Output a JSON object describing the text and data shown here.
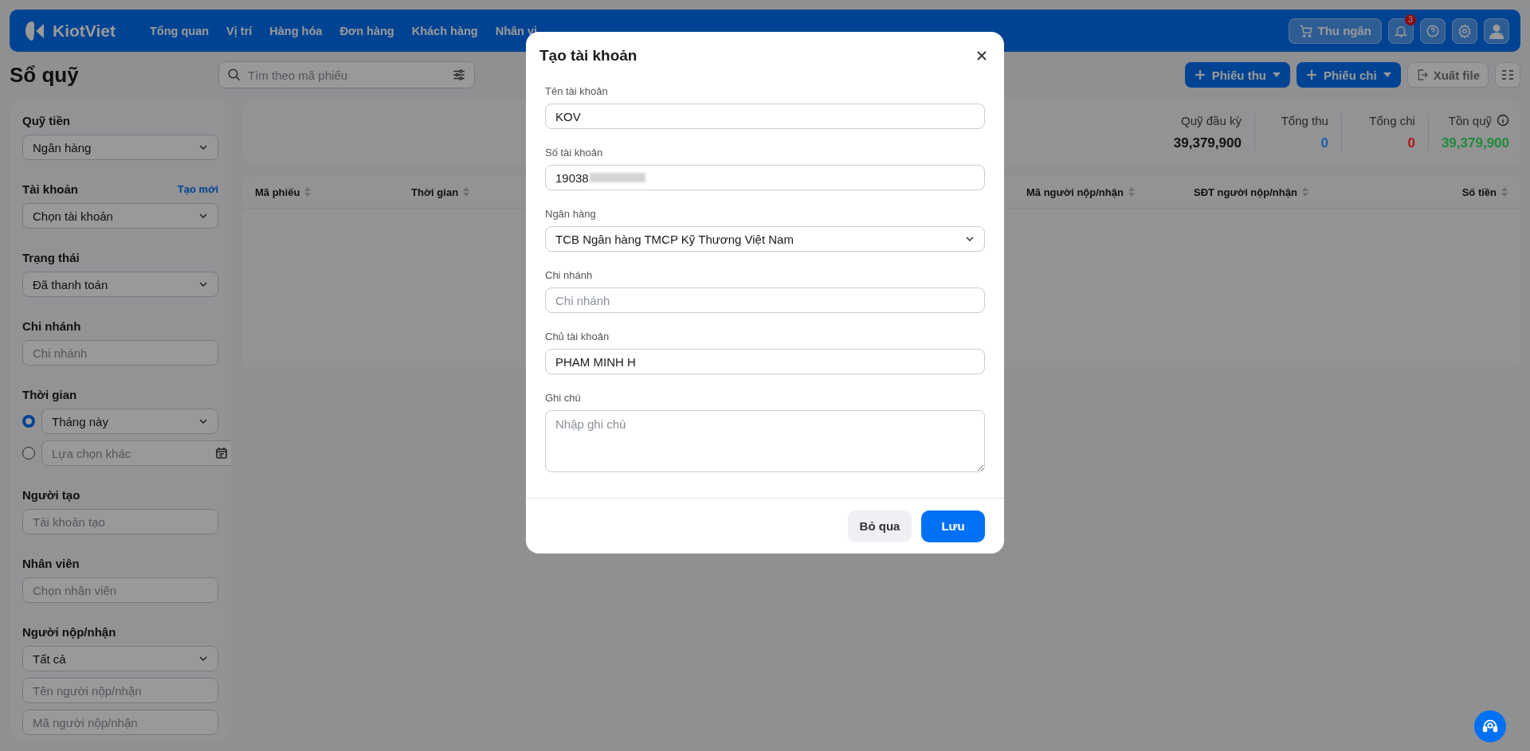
{
  "topbar": {
    "brand": "KiotViet",
    "nav": [
      {
        "label": "Tổng quan"
      },
      {
        "label": "Vị trí"
      },
      {
        "label": "Hàng hóa"
      },
      {
        "label": "Đơn hàng"
      },
      {
        "label": "Khách hàng"
      },
      {
        "label": "Nhân vi"
      }
    ],
    "cashier_button": "Thu ngân",
    "notification_count": "3"
  },
  "page_title": "Sổ quỹ",
  "search": {
    "placeholder": "Tìm theo mã phiếu"
  },
  "actions": [
    {
      "kind": "primary",
      "label": "Phiếu thu"
    },
    {
      "kind": "primary",
      "label": "Phiếu chi"
    },
    {
      "kind": "export",
      "label": "Xuất file"
    }
  ],
  "sidebar": {
    "sections": [
      {
        "title": "Quỹ tiền",
        "fields": [
          {
            "kind": "select",
            "value": "Ngân hàng"
          }
        ]
      },
      {
        "title": "Tài khoản",
        "link": "Tạo mới",
        "fields": [
          {
            "kind": "select",
            "value": "Chọn tài khoản"
          }
        ]
      },
      {
        "title": "Trạng thái",
        "fields": [
          {
            "kind": "select",
            "value": "Đã thanh toán"
          }
        ]
      },
      {
        "title": "Chi nhánh",
        "fields": [
          {
            "kind": "input",
            "placeholder": "Chi nhánh"
          }
        ]
      },
      {
        "title": "Thời gian",
        "fields": [
          {
            "kind": "radio-select",
            "selected": true,
            "value": "Tháng này"
          },
          {
            "kind": "radio-date",
            "selected": false,
            "placeholder": "Lựa chọn khác"
          }
        ]
      },
      {
        "title": "Người tạo",
        "fields": [
          {
            "kind": "input",
            "placeholder": "Tài khoản tạo"
          }
        ]
      },
      {
        "title": "Nhân viên",
        "fields": [
          {
            "kind": "input",
            "placeholder": "Chọn nhân viên"
          }
        ]
      },
      {
        "title": "Người nộp/nhận",
        "fields": [
          {
            "kind": "select",
            "value": "Tất cả"
          },
          {
            "kind": "input",
            "placeholder": "Tên người nộp/nhận"
          },
          {
            "kind": "input",
            "placeholder": "Mã người nộp/nhận"
          }
        ]
      }
    ]
  },
  "summary": [
    {
      "label": "Quỹ đầu kỳ",
      "value": "39,379,900",
      "color": "#111111"
    },
    {
      "label": "Tổng thu",
      "value": "0",
      "color": "#1a5cb0"
    },
    {
      "label": "Tổng chi",
      "value": "0",
      "color": "#b51515"
    },
    {
      "label": "Tồn quỹ",
      "value": "39,379,900",
      "color": "#1f8a3a",
      "info": true
    }
  ],
  "table": {
    "columns": [
      {
        "label": "Mã phiếu"
      },
      {
        "label": "Thời gian"
      },
      {
        "label": "Mã người nộp/nhận"
      },
      {
        "label": "SĐT người nộp/nhận"
      },
      {
        "label": "Số tiền"
      }
    ]
  },
  "dialog": {
    "title": "Tạo tài khoản",
    "fields": [
      {
        "kind": "input",
        "label": "Tên tài khoản",
        "value": "KOV"
      },
      {
        "kind": "input",
        "label": "Số tài khoản",
        "value": "19038",
        "masked": true
      },
      {
        "kind": "select",
        "label": "Ngân hàng",
        "value": "TCB Ngân hàng TMCP Kỹ Thương Việt Nam"
      },
      {
        "kind": "input",
        "label": "Chi nhánh",
        "placeholder": "Chi nhánh"
      },
      {
        "kind": "input",
        "label": "Chủ tài khoản",
        "value": "PHAM MINH H"
      },
      {
        "kind": "textarea",
        "label": "Ghi chú",
        "placeholder": "Nhập ghi chú"
      }
    ],
    "buttons": [
      {
        "kind": "secondary",
        "label": "Bỏ qua"
      },
      {
        "kind": "primary",
        "label": "Lưu"
      }
    ]
  }
}
